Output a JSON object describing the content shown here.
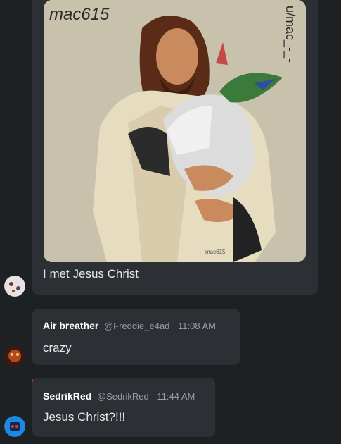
{
  "messages": [
    {
      "image": {
        "name": "shared-image",
        "signature_text": "mac615",
        "side_text": "u/mac_-_-",
        "bottom_signature": "mac615"
      },
      "text": "I met Jesus Christ",
      "avatar": "avatar-user-1"
    },
    {
      "author": "Air breather",
      "handle": "@Freddie_e4ad",
      "time": "11:08 AM",
      "text": "crazy",
      "avatar": "avatar-user-2"
    },
    {
      "author": "SedrikRed",
      "handle": "@SedrikRed",
      "time": "11:44 AM",
      "text": "Jesus Christ?!!!",
      "avatar": "avatar-user-3",
      "badge": "crown-icon"
    }
  ],
  "colors": {
    "background": "#1e2124",
    "bubble": "#2c2f33",
    "text": "#e6e7e8",
    "muted": "#9a9da1",
    "crown": "#e53935"
  }
}
